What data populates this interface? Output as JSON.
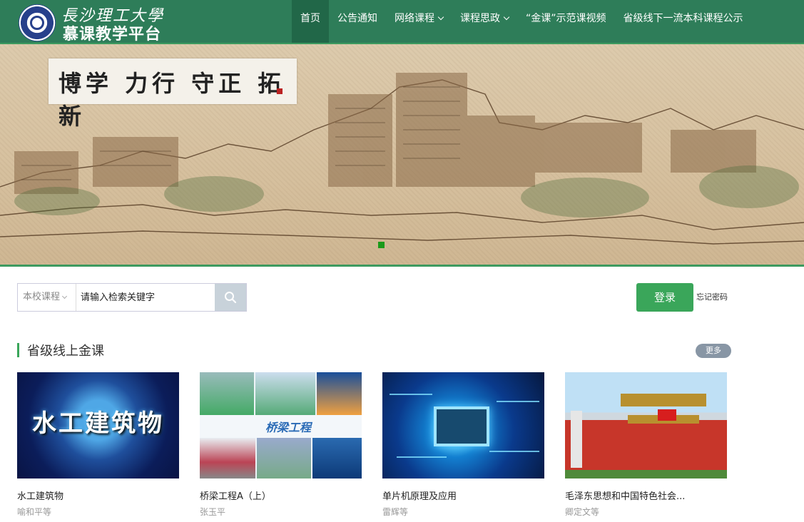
{
  "header": {
    "logo_calligraphy": "長沙理工大學",
    "logo_title": "慕课教学平台",
    "nav": [
      {
        "label": "首页",
        "active": true,
        "dropdown": false
      },
      {
        "label": "公告通知",
        "active": false,
        "dropdown": false
      },
      {
        "label": "网络课程",
        "active": false,
        "dropdown": true
      },
      {
        "label": "课程思政",
        "active": false,
        "dropdown": true
      },
      {
        "label": "“金课”示范课视频",
        "active": false,
        "dropdown": false
      },
      {
        "label": "省级线下一流本科课程公示",
        "active": false,
        "dropdown": false
      }
    ]
  },
  "banner": {
    "calligraphy": "博学 力行 守正 拓新",
    "active_slide": 1
  },
  "search": {
    "scope": "本校课程",
    "placeholder": "请输入检索关键字",
    "button_icon": "search-icon"
  },
  "auth": {
    "login_label": "登录",
    "forgot_label": "忘记密码"
  },
  "section": {
    "title": "省级线上金课",
    "more_label": "更多",
    "courses": [
      {
        "name": "水工建筑物",
        "teacher": "喻和平等",
        "thumb_text": "水工建筑物"
      },
      {
        "name": "桥梁工程A（上）",
        "teacher": "张玉平",
        "thumb_text": "桥梁工程"
      },
      {
        "name": "单片机原理及应用",
        "teacher": "雷辉等",
        "thumb_text": ""
      },
      {
        "name": "毛泽东思想和中国特色社会...",
        "teacher": "卿定文等",
        "thumb_text": ""
      }
    ]
  },
  "colors": {
    "header_bg": "#2e7d59",
    "nav_active": "#216748",
    "accent_green": "#3aa65a",
    "more_button": "#8896a5"
  }
}
